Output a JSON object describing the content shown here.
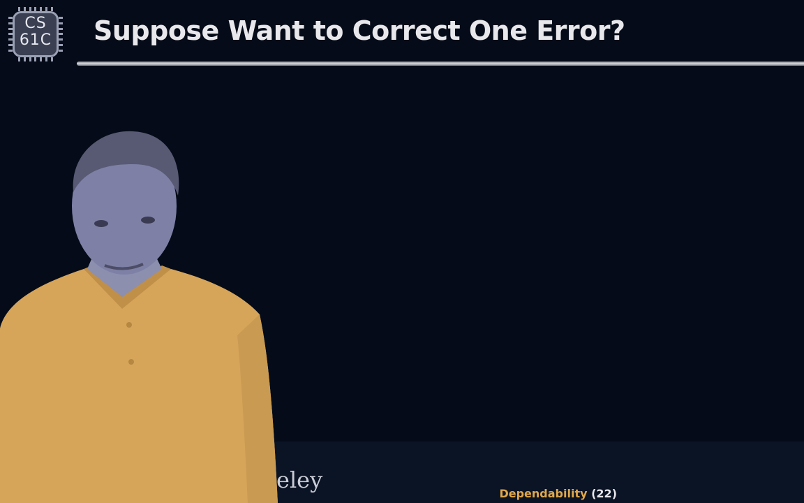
{
  "slide": {
    "title": "Suppose Want to Correct One Error?",
    "logo_line1": "CS",
    "logo_line2": "61C",
    "watermark_text": "eley",
    "footer": {
      "topic": "Dependability",
      "slide_number": "(22)"
    }
  },
  "colors": {
    "background": "#050b18",
    "title_text": "#e8e8ec",
    "footer_topic": "#e0a84a",
    "presenter_shirt": "#d6a55a"
  },
  "icons": {
    "logo": "cs61c-chip-logo-icon"
  }
}
